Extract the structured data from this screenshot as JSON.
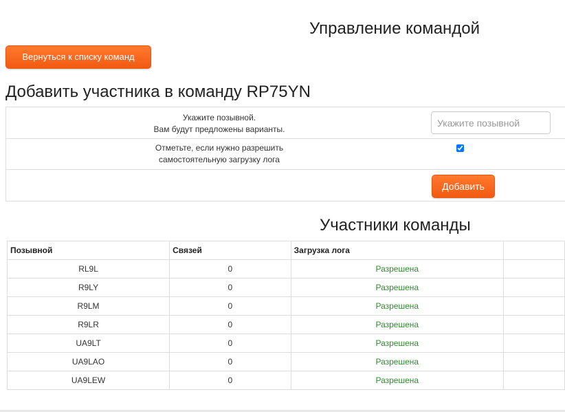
{
  "page_title": "Управление командой",
  "back_button_label": "Вернуться к списку команд",
  "add_section": {
    "title": "Добавить участника в команду RP75YN",
    "callsign_label_line1": "Укажите позывной.",
    "callsign_label_line2": "Вам будут предложены варианты.",
    "callsign_placeholder": "Укажите позывной",
    "callsign_value": "",
    "log_permission_line1": "Отметьте, если нужно разрешить",
    "log_permission_line2": "самостоятельную загрузку лога",
    "log_permission_checked": true,
    "add_button_label": "Добавить"
  },
  "members_section": {
    "title": "Участники команды",
    "columns": [
      "Позывной",
      "Связей",
      "Загрузка лога",
      ""
    ],
    "rows": [
      {
        "callsign": "RL9L",
        "qsos": "0",
        "log_upload": "Разрешена"
      },
      {
        "callsign": "R9LY",
        "qsos": "0",
        "log_upload": "Разрешена"
      },
      {
        "callsign": "R9LM",
        "qsos": "0",
        "log_upload": "Разрешена"
      },
      {
        "callsign": "R9LR",
        "qsos": "0",
        "log_upload": "Разрешена"
      },
      {
        "callsign": "UA9LT",
        "qsos": "0",
        "log_upload": "Разрешена"
      },
      {
        "callsign": "UA9LAO",
        "qsos": "0",
        "log_upload": "Разрешена"
      },
      {
        "callsign": "UA9LEW",
        "qsos": "0",
        "log_upload": "Разрешена"
      }
    ]
  },
  "colors": {
    "accent": "#f15a12",
    "status_allowed": "#2e8b2e"
  }
}
